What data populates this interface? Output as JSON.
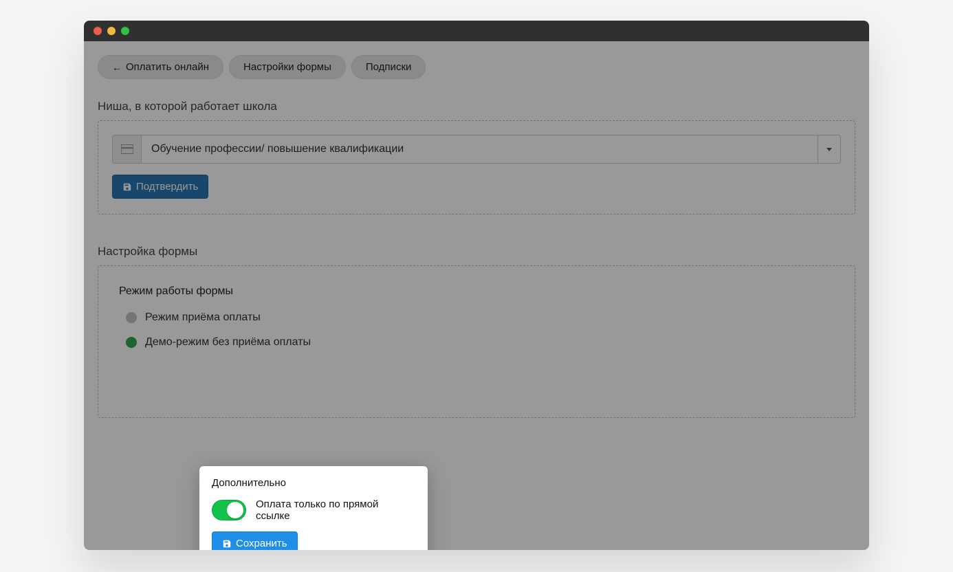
{
  "tabs": {
    "pay_online": "Оплатить онлайн",
    "form_settings": "Настройки формы",
    "subscriptions": "Подписки"
  },
  "niche": {
    "heading": "Ниша, в которой работает школа",
    "selected": "Обучение профессии/ повышение квалификации",
    "confirm_label": "Подтвердить"
  },
  "form_section": {
    "heading": "Настройка формы",
    "mode_heading": "Режим работы формы",
    "options": [
      {
        "label": "Режим приёма оплаты",
        "selected": false
      },
      {
        "label": "Демо-режим без приёма оплаты",
        "selected": true
      }
    ]
  },
  "additional": {
    "heading": "Дополнительно",
    "toggle_label": "Оплата только по прямой ссылке",
    "toggle_on": true,
    "save_label": "Сохранить"
  }
}
